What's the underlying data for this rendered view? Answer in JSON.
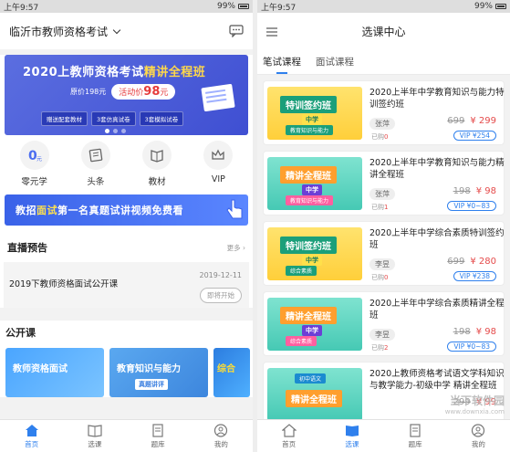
{
  "left": {
    "status": {
      "time": "上午9:57",
      "battery": "99%"
    },
    "header": {
      "title": "临沂市教师资格考试"
    },
    "banner": {
      "title_prefix": "2020上教师资格考试",
      "title_highlight": "精讲全程班",
      "orig_price": "原价198元",
      "promo_label": "活动价",
      "promo_price": "98",
      "promo_unit": "元",
      "chips": [
        "赠送配套教材",
        "3套仿真试卷",
        "3套模拟试卷"
      ]
    },
    "quick": [
      {
        "label": "零元学",
        "icon": "zero-icon"
      },
      {
        "label": "头条",
        "icon": "news-icon"
      },
      {
        "label": "教材",
        "icon": "book-icon"
      },
      {
        "label": "VIP",
        "icon": "crown-icon"
      }
    ],
    "strip": {
      "a": "教招",
      "b": "面试",
      "c": "第一名真题试讲视频免费看"
    },
    "live_section": {
      "title": "直播预告",
      "more": "更多 ›"
    },
    "live_item": {
      "title": "2019下教师资格面试公开课",
      "date": "2019-12-11",
      "button": "即将开始"
    },
    "public_section": {
      "title": "公开课"
    },
    "public_cards": [
      {
        "title": "教师资格面试",
        "sub": ""
      },
      {
        "title": "教育知识与能力",
        "sub": "真题讲评"
      },
      {
        "title": "综合",
        "sub": ""
      }
    ],
    "tabs": [
      {
        "label": "首页",
        "active": true,
        "icon": "home-icon"
      },
      {
        "label": "选课",
        "active": false,
        "icon": "course-icon"
      },
      {
        "label": "题库",
        "active": false,
        "icon": "question-bank-icon"
      },
      {
        "label": "我的",
        "active": false,
        "icon": "profile-icon"
      }
    ]
  },
  "right": {
    "status": {
      "time": "上午9:57",
      "battery": "99%"
    },
    "header": {
      "title": "选课中心"
    },
    "tabs": [
      {
        "label": "笔试课程",
        "active": true
      },
      {
        "label": "面试课程",
        "active": false
      }
    ],
    "courses": [
      {
        "thumb_style": "yellow",
        "thumb_main": "特训签约班",
        "thumb_sub": "中学",
        "thumb_tag": "教育知识与能力",
        "thumb_top": "",
        "title": "2020上半年中学教育知识与能力特训签约班",
        "teacher": "张萍",
        "bought_label": "已购",
        "bought": "0",
        "old_price": "699",
        "price": "¥ 299",
        "vip": "VIP ¥254"
      },
      {
        "thumb_style": "teal",
        "thumb_main": "精讲全程班",
        "thumb_sub": "中学",
        "thumb_tag": "教育知识与能力",
        "thumb_top": "",
        "title": "2020上半年中学教育知识与能力精讲全程班",
        "teacher": "张萍",
        "bought_label": "已购",
        "bought": "1",
        "old_price": "198",
        "price": "¥ 98",
        "vip": "VIP ¥0~83"
      },
      {
        "thumb_style": "yellow",
        "thumb_main": "特训签约班",
        "thumb_sub": "中学",
        "thumb_tag": "综合素质",
        "thumb_top": "",
        "title": "2020上半年中学综合素质特训签约班",
        "teacher": "李昱",
        "bought_label": "已购",
        "bought": "0",
        "old_price": "699",
        "price": "¥ 280",
        "vip": "VIP ¥238"
      },
      {
        "thumb_style": "teal",
        "thumb_main": "精讲全程班",
        "thumb_sub": "中学",
        "thumb_tag": "综合素质",
        "thumb_top": "",
        "title": "2020上半年中学综合素质精讲全程班",
        "teacher": "李昱",
        "bought_label": "已购",
        "bought": "2",
        "old_price": "198",
        "price": "¥ 98",
        "vip": "VIP ¥0~83"
      },
      {
        "thumb_style": "teal",
        "thumb_main": "精讲全程班",
        "thumb_sub": "",
        "thumb_tag": "",
        "thumb_top": "初中语文",
        "title": "2020上教师资格考试语文学科知识与教学能力-初级中学 精讲全程班",
        "teacher": "",
        "bought_label": "",
        "bought": "",
        "old_price": "299",
        "price": "¥ 99",
        "vip": ""
      }
    ],
    "watermark": {
      "text": "当下软件园",
      "sub": "www.downxia.com"
    },
    "bottom_tabs": [
      {
        "label": "首页",
        "active": false,
        "icon": "home-icon"
      },
      {
        "label": "选课",
        "active": true,
        "icon": "course-icon"
      },
      {
        "label": "题库",
        "active": false,
        "icon": "question-bank-icon"
      },
      {
        "label": "我的",
        "active": false,
        "icon": "profile-icon"
      }
    ]
  }
}
